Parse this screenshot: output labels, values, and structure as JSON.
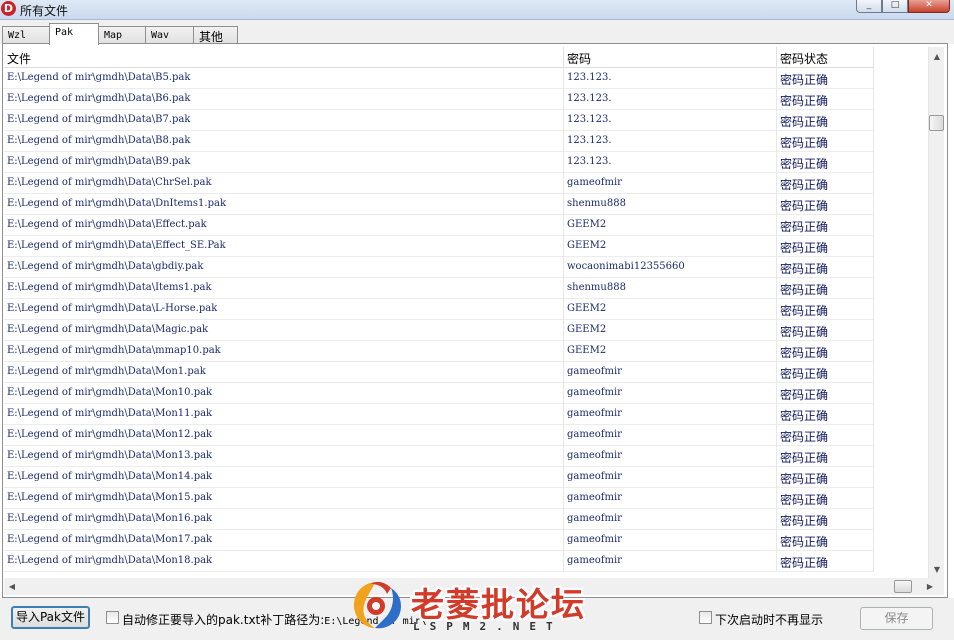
{
  "window": {
    "title": "所有文件",
    "app_icon_letter": "D",
    "controls": {
      "minimize": "_",
      "maximize": "□",
      "close": "✕"
    }
  },
  "tabs": [
    {
      "label": "Wzl",
      "active": false
    },
    {
      "label": "Pak",
      "active": true
    },
    {
      "label": "Map",
      "active": false
    },
    {
      "label": "Wav",
      "active": false
    },
    {
      "label": "其他",
      "active": false
    }
  ],
  "grid": {
    "columns": [
      "文件",
      "密码",
      "密码状态"
    ],
    "rows": [
      [
        "E:\\Legend of mir\\gmdh\\Data\\B5.pak",
        "123.123.",
        "密码正确"
      ],
      [
        "E:\\Legend of mir\\gmdh\\Data\\B6.pak",
        "123.123.",
        "密码正确"
      ],
      [
        "E:\\Legend of mir\\gmdh\\Data\\B7.pak",
        "123.123.",
        "密码正确"
      ],
      [
        "E:\\Legend of mir\\gmdh\\Data\\B8.pak",
        "123.123.",
        "密码正确"
      ],
      [
        "E:\\Legend of mir\\gmdh\\Data\\B9.pak",
        "123.123.",
        "密码正确"
      ],
      [
        "E:\\Legend of mir\\gmdh\\Data\\ChrSel.pak",
        "gameofmir",
        "密码正确"
      ],
      [
        "E:\\Legend of mir\\gmdh\\Data\\DnItems1.pak",
        "shenmu888",
        "密码正确"
      ],
      [
        "E:\\Legend of mir\\gmdh\\Data\\Effect.pak",
        "GEEM2",
        "密码正确"
      ],
      [
        "E:\\Legend of mir\\gmdh\\Data\\Effect_SE.Pak",
        "GEEM2",
        "密码正确"
      ],
      [
        "E:\\Legend of mir\\gmdh\\Data\\gbdiy.pak",
        "wocaonimabi12355660",
        "密码正确"
      ],
      [
        "E:\\Legend of mir\\gmdh\\Data\\Items1.pak",
        "shenmu888",
        "密码正确"
      ],
      [
        "E:\\Legend of mir\\gmdh\\Data\\L-Horse.pak",
        "GEEM2",
        "密码正确"
      ],
      [
        "E:\\Legend of mir\\gmdh\\Data\\Magic.pak",
        "GEEM2",
        "密码正确"
      ],
      [
        "E:\\Legend of mir\\gmdh\\Data\\mmap10.pak",
        "GEEM2",
        "密码正确"
      ],
      [
        "E:\\Legend of mir\\gmdh\\Data\\Mon1.pak",
        "gameofmir",
        "密码正确"
      ],
      [
        "E:\\Legend of mir\\gmdh\\Data\\Mon10.pak",
        "gameofmir",
        "密码正确"
      ],
      [
        "E:\\Legend of mir\\gmdh\\Data\\Mon11.pak",
        "gameofmir",
        "密码正确"
      ],
      [
        "E:\\Legend of mir\\gmdh\\Data\\Mon12.pak",
        "gameofmir",
        "密码正确"
      ],
      [
        "E:\\Legend of mir\\gmdh\\Data\\Mon13.pak",
        "gameofmir",
        "密码正确"
      ],
      [
        "E:\\Legend of mir\\gmdh\\Data\\Mon14.pak",
        "gameofmir",
        "密码正确"
      ],
      [
        "E:\\Legend of mir\\gmdh\\Data\\Mon15.pak",
        "gameofmir",
        "密码正确"
      ],
      [
        "E:\\Legend of mir\\gmdh\\Data\\Mon16.pak",
        "gameofmir",
        "密码正确"
      ],
      [
        "E:\\Legend of mir\\gmdh\\Data\\Mon17.pak",
        "gameofmir",
        "密码正确"
      ],
      [
        "E:\\Legend of mir\\gmdh\\Data\\Mon18.pak",
        "gameofmir",
        "密码正确"
      ]
    ]
  },
  "bottom_bar": {
    "import_button": "导入Pak文件",
    "auto_fix_label": "自动修正要导入的pak.txt补丁路径为:",
    "auto_fix_path": "E:\\Legend of mir\\",
    "auto_fix_checked": false,
    "no_show_label": "下次启动时不再显示",
    "no_show_checked": false,
    "save_button": "保存"
  },
  "watermark": {
    "main": "老菱批论坛",
    "sub": "LSPM2.NET"
  },
  "colors": {
    "cell_text": "#1a2a6c",
    "title_bar": "#c9d9ee",
    "close_button": "#c8412f",
    "watermark_red": "#d23a2a"
  }
}
